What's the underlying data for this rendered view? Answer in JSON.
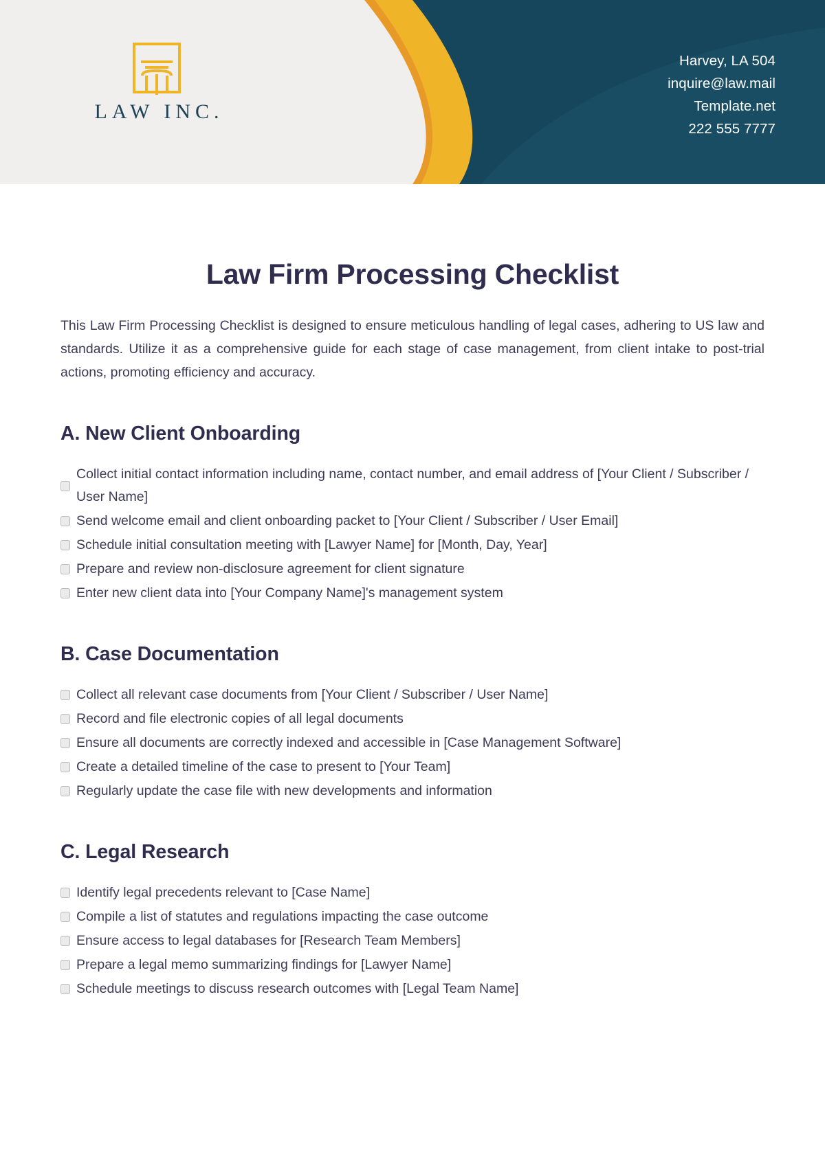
{
  "brand": {
    "name": "LAW INC.",
    "logo_icon": "pillar-column-icon",
    "colors": {
      "gold": "#f0b429",
      "orange": "#e89a28",
      "teal_dark": "#16465c",
      "teal_mid": "#1b536c",
      "header_bg": "#f0efed",
      "navy_text": "#2f2c4e"
    }
  },
  "contact": {
    "address": "Harvey, LA 504",
    "email": "inquire@law.mail",
    "website": "Template.net",
    "phone": "222 555 7777"
  },
  "document": {
    "title": "Law Firm Processing Checklist",
    "intro": "This Law Firm Processing Checklist is designed to ensure meticulous handling of legal cases, adhering to US law and standards. Utilize it as a comprehensive guide for each stage of case management, from client intake to post-trial actions, promoting efficiency and accuracy."
  },
  "sections": [
    {
      "heading": "A. New Client Onboarding",
      "items": [
        "Collect initial contact information including name, contact number, and email address of [Your Client / Subscriber / User Name]",
        "Send welcome email and client onboarding packet to [Your Client / Subscriber / User Email]",
        "Schedule initial consultation meeting with [Lawyer Name] for [Month, Day, Year]",
        "Prepare and review non-disclosure agreement for client signature",
        "Enter new client data into [Your Company Name]'s management system"
      ]
    },
    {
      "heading": "B. Case Documentation",
      "items": [
        "Collect all relevant case documents from [Your Client / Subscriber / User Name]",
        "Record and file electronic copies of all legal documents",
        "Ensure all documents are correctly indexed and accessible in [Case Management Software]",
        "Create a detailed timeline of the case to present to [Your Team]",
        "Regularly update the case file with new developments and information"
      ]
    },
    {
      "heading": "C. Legal Research",
      "items": [
        "Identify legal precedents relevant to [Case Name]",
        "Compile a list of statutes and regulations impacting the case outcome",
        "Ensure access to legal databases for [Research Team Members]",
        "Prepare a legal memo summarizing findings for [Lawyer Name]",
        "Schedule meetings to discuss research outcomes with [Legal Team Name]"
      ]
    }
  ]
}
